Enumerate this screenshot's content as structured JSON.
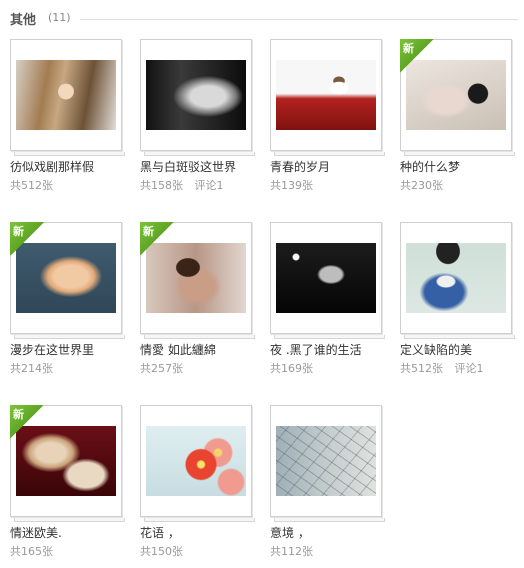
{
  "section": {
    "title": "其他",
    "count": "(11)"
  },
  "albums": [
    {
      "title": "彷似戏剧那样假",
      "photos": "共512张",
      "comments": "",
      "is_new": false,
      "new_label": ""
    },
    {
      "title": "黑与白斑驳这世界",
      "photos": "共158张",
      "comments": "评论1",
      "is_new": false,
      "new_label": ""
    },
    {
      "title": "青春的岁月",
      "photos": "共139张",
      "comments": "",
      "is_new": false,
      "new_label": ""
    },
    {
      "title": "种的什么梦",
      "photos": "共230张",
      "comments": "",
      "is_new": true,
      "new_label": "新"
    },
    {
      "title": "漫步在这世界里",
      "photos": "共214张",
      "comments": "",
      "is_new": true,
      "new_label": "新"
    },
    {
      "title": "情愛 如此纏綿",
      "photos": "共257张",
      "comments": "",
      "is_new": true,
      "new_label": "新"
    },
    {
      "title": "夜 .黑了谁的生活",
      "photos": "共169张",
      "comments": "",
      "is_new": false,
      "new_label": ""
    },
    {
      "title": "定义缺陷的美",
      "photos": "共512张",
      "comments": "评论1",
      "is_new": false,
      "new_label": ""
    },
    {
      "title": "情迷欧美.",
      "photos": "共165张",
      "comments": "",
      "is_new": true,
      "new_label": "新"
    },
    {
      "title": "花语 ，",
      "photos": "共150张",
      "comments": "",
      "is_new": false,
      "new_label": ""
    },
    {
      "title": "意境 ，",
      "photos": "共112张",
      "comments": "",
      "is_new": false,
      "new_label": ""
    }
  ]
}
